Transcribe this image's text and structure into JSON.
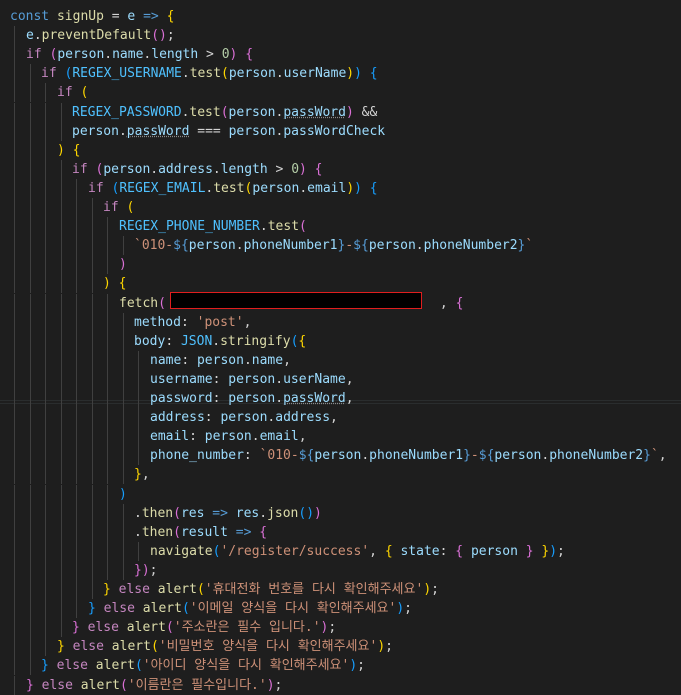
{
  "editor": {
    "lines": [
      [
        [
          "kw",
          "const"
        ],
        [
          "pun",
          " "
        ],
        [
          "fn",
          "signUp"
        ],
        [
          "pun",
          " "
        ],
        [
          "pun",
          "="
        ],
        [
          "pun",
          " "
        ],
        [
          "var",
          "e"
        ],
        [
          "pun",
          " "
        ],
        [
          "kw",
          "=>"
        ],
        [
          "pun",
          " "
        ],
        [
          "p1",
          "{"
        ]
      ],
      [
        [
          "var",
          "e"
        ],
        [
          "pun",
          "."
        ],
        [
          "fn",
          "preventDefault"
        ],
        [
          "p2",
          "()"
        ],
        [
          "pun",
          ";"
        ]
      ],
      [
        [
          "ctl",
          "if"
        ],
        [
          "pun",
          " "
        ],
        [
          "p2",
          "("
        ],
        [
          "var",
          "person"
        ],
        [
          "pun",
          "."
        ],
        [
          "var",
          "name"
        ],
        [
          "pun",
          "."
        ],
        [
          "var",
          "length"
        ],
        [
          "pun",
          " > "
        ],
        [
          "num",
          "0"
        ],
        [
          "p2",
          ")"
        ],
        [
          "pun",
          " "
        ],
        [
          "p2",
          "{"
        ]
      ],
      [
        [
          "ctl",
          "if"
        ],
        [
          "pun",
          " "
        ],
        [
          "p3",
          "("
        ],
        [
          "cst",
          "REGEX_USERNAME"
        ],
        [
          "pun",
          "."
        ],
        [
          "fn",
          "test"
        ],
        [
          "p1",
          "("
        ],
        [
          "var",
          "person"
        ],
        [
          "pun",
          "."
        ],
        [
          "var",
          "userName"
        ],
        [
          "p1",
          ")"
        ],
        [
          "p3",
          ")"
        ],
        [
          "pun",
          " "
        ],
        [
          "p3",
          "{"
        ]
      ],
      [
        [
          "ctl",
          "if"
        ],
        [
          "pun",
          " "
        ],
        [
          "p1",
          "("
        ]
      ],
      [
        [
          "cst",
          "REGEX_PASSWORD"
        ],
        [
          "pun",
          "."
        ],
        [
          "fn",
          "test"
        ],
        [
          "p2",
          "("
        ],
        [
          "var",
          "person"
        ],
        [
          "pun",
          "."
        ],
        [
          "var",
          "passWord"
        ],
        [
          "p2",
          ")"
        ],
        [
          "pun",
          " &&"
        ]
      ],
      [
        [
          "var",
          "person"
        ],
        [
          "pun",
          "."
        ],
        [
          "var",
          "passWord"
        ],
        [
          "pun",
          " === "
        ],
        [
          "var",
          "person"
        ],
        [
          "pun",
          "."
        ],
        [
          "var",
          "passWordCheck"
        ]
      ],
      [
        [
          "p1",
          ")"
        ],
        [
          "pun",
          " "
        ],
        [
          "p1",
          "{"
        ]
      ],
      [
        [
          "ctl",
          "if"
        ],
        [
          "pun",
          " "
        ],
        [
          "p2",
          "("
        ],
        [
          "var",
          "person"
        ],
        [
          "pun",
          "."
        ],
        [
          "var",
          "address"
        ],
        [
          "pun",
          "."
        ],
        [
          "var",
          "length"
        ],
        [
          "pun",
          " > "
        ],
        [
          "num",
          "0"
        ],
        [
          "p2",
          ")"
        ],
        [
          "pun",
          " "
        ],
        [
          "p2",
          "{"
        ]
      ],
      [
        [
          "ctl",
          "if"
        ],
        [
          "pun",
          " "
        ],
        [
          "p3",
          "("
        ],
        [
          "cst",
          "REGEX_EMAIL"
        ],
        [
          "pun",
          "."
        ],
        [
          "fn",
          "test"
        ],
        [
          "p1",
          "("
        ],
        [
          "var",
          "person"
        ],
        [
          "pun",
          "."
        ],
        [
          "var",
          "email"
        ],
        [
          "p1",
          ")"
        ],
        [
          "p3",
          ")"
        ],
        [
          "pun",
          " "
        ],
        [
          "p3",
          "{"
        ]
      ],
      [
        [
          "ctl",
          "if"
        ],
        [
          "pun",
          " "
        ],
        [
          "p1",
          "("
        ]
      ],
      [
        [
          "cst",
          "REGEX_PHONE_NUMBER"
        ],
        [
          "pun",
          "."
        ],
        [
          "fn",
          "test"
        ],
        [
          "p2",
          "("
        ]
      ],
      [
        [
          "str",
          "`010-"
        ],
        [
          "kw",
          "${"
        ],
        [
          "var",
          "person"
        ],
        [
          "pun",
          "."
        ],
        [
          "var",
          "phoneNumber1"
        ],
        [
          "kw",
          "}"
        ],
        [
          "str",
          "-"
        ],
        [
          "kw",
          "${"
        ],
        [
          "var",
          "person"
        ],
        [
          "pun",
          "."
        ],
        [
          "var",
          "phoneNumber2"
        ],
        [
          "kw",
          "}"
        ],
        [
          "str",
          "`"
        ]
      ],
      [
        [
          "p2",
          ")"
        ]
      ],
      [
        [
          "p1",
          ")"
        ],
        [
          "pun",
          " "
        ],
        [
          "p1",
          "{"
        ]
      ],
      [
        [
          "fn",
          "fetch"
        ],
        [
          "p2",
          "("
        ],
        [
          "pun",
          "                                   "
        ],
        [
          "pun",
          ", "
        ],
        [
          "p2",
          "{"
        ]
      ],
      [
        [
          "var",
          "method"
        ],
        [
          "pun",
          ": "
        ],
        [
          "str",
          "'post'"
        ],
        [
          "pun",
          ","
        ]
      ],
      [
        [
          "var",
          "body"
        ],
        [
          "pun",
          ": "
        ],
        [
          "cst",
          "JSON"
        ],
        [
          "pun",
          "."
        ],
        [
          "fn",
          "stringify"
        ],
        [
          "p3",
          "("
        ],
        [
          "p1",
          "{"
        ]
      ],
      [
        [
          "var",
          "name"
        ],
        [
          "pun",
          ": "
        ],
        [
          "var",
          "person"
        ],
        [
          "pun",
          "."
        ],
        [
          "var",
          "name"
        ],
        [
          "pun",
          ","
        ]
      ],
      [
        [
          "var",
          "username"
        ],
        [
          "pun",
          ": "
        ],
        [
          "var",
          "person"
        ],
        [
          "pun",
          "."
        ],
        [
          "var",
          "userName"
        ],
        [
          "pun",
          ","
        ]
      ],
      [
        [
          "var",
          "password"
        ],
        [
          "pun",
          ": "
        ],
        [
          "var",
          "person"
        ],
        [
          "pun",
          "."
        ],
        [
          "var",
          "passWord"
        ],
        [
          "pun",
          ","
        ]
      ],
      [
        [
          "var",
          "address"
        ],
        [
          "pun",
          ": "
        ],
        [
          "var",
          "person"
        ],
        [
          "pun",
          "."
        ],
        [
          "var",
          "address"
        ],
        [
          "pun",
          ","
        ]
      ],
      [
        [
          "var",
          "email"
        ],
        [
          "pun",
          ": "
        ],
        [
          "var",
          "person"
        ],
        [
          "pun",
          "."
        ],
        [
          "var",
          "email"
        ],
        [
          "pun",
          ","
        ]
      ],
      [
        [
          "var",
          "phone_number"
        ],
        [
          "pun",
          ": "
        ],
        [
          "str",
          "`010-"
        ],
        [
          "kw",
          "${"
        ],
        [
          "var",
          "person"
        ],
        [
          "pun",
          "."
        ],
        [
          "var",
          "phoneNumber1"
        ],
        [
          "kw",
          "}"
        ],
        [
          "str",
          "-"
        ],
        [
          "kw",
          "${"
        ],
        [
          "var",
          "person"
        ],
        [
          "pun",
          "."
        ],
        [
          "var",
          "phoneNumber2"
        ],
        [
          "kw",
          "}"
        ],
        [
          "str",
          "`"
        ],
        [
          "pun",
          ","
        ]
      ],
      [
        [
          "p1",
          "}"
        ],
        [
          "pun",
          ","
        ]
      ],
      [
        [
          "p3",
          ")"
        ]
      ],
      [
        [
          "pun",
          "."
        ],
        [
          "fn",
          "then"
        ],
        [
          "p2",
          "("
        ],
        [
          "var",
          "res"
        ],
        [
          "pun",
          " "
        ],
        [
          "kw",
          "=>"
        ],
        [
          "pun",
          " "
        ],
        [
          "var",
          "res"
        ],
        [
          "pun",
          "."
        ],
        [
          "fn",
          "json"
        ],
        [
          "p3",
          "()"
        ],
        [
          "p2",
          ")"
        ]
      ],
      [
        [
          "pun",
          "."
        ],
        [
          "fn",
          "then"
        ],
        [
          "p2",
          "("
        ],
        [
          "var",
          "result"
        ],
        [
          "pun",
          " "
        ],
        [
          "kw",
          "=>"
        ],
        [
          "pun",
          " "
        ],
        [
          "p2",
          "{"
        ]
      ],
      [
        [
          "fn",
          "navigate"
        ],
        [
          "p3",
          "("
        ],
        [
          "str",
          "'/register/success'"
        ],
        [
          "pun",
          ", "
        ],
        [
          "p1",
          "{"
        ],
        [
          "pun",
          " "
        ],
        [
          "var",
          "state"
        ],
        [
          "pun",
          ": "
        ],
        [
          "p2",
          "{"
        ],
        [
          "pun",
          " "
        ],
        [
          "var",
          "person"
        ],
        [
          "pun",
          " "
        ],
        [
          "p2",
          "}"
        ],
        [
          "pun",
          " "
        ],
        [
          "p1",
          "}"
        ],
        [
          "p3",
          ")"
        ],
        [
          "pun",
          ";"
        ]
      ],
      [
        [
          "p2",
          "}"
        ],
        [
          "p2",
          ")"
        ],
        [
          "pun",
          ";"
        ]
      ],
      [
        [
          "p1",
          "}"
        ],
        [
          "pun",
          " "
        ],
        [
          "ctl",
          "else"
        ],
        [
          "pun",
          " "
        ],
        [
          "fn",
          "alert"
        ],
        [
          "p1",
          "("
        ],
        [
          "str",
          "'휴대전화 번호를 다시 확인해주세요'"
        ],
        [
          "p1",
          ")"
        ],
        [
          "pun",
          ";"
        ]
      ],
      [
        [
          "p3",
          "}"
        ],
        [
          "pun",
          " "
        ],
        [
          "ctl",
          "else"
        ],
        [
          "pun",
          " "
        ],
        [
          "fn",
          "alert"
        ],
        [
          "p3",
          "("
        ],
        [
          "str",
          "'이메일 양식을 다시 확인해주세요'"
        ],
        [
          "p3",
          ")"
        ],
        [
          "pun",
          ";"
        ]
      ],
      [
        [
          "p2",
          "}"
        ],
        [
          "pun",
          " "
        ],
        [
          "ctl",
          "else"
        ],
        [
          "pun",
          " "
        ],
        [
          "fn",
          "alert"
        ],
        [
          "p2",
          "("
        ],
        [
          "str",
          "'주소란은 필수 입니다.'"
        ],
        [
          "p2",
          ")"
        ],
        [
          "pun",
          ";"
        ]
      ],
      [
        [
          "p1",
          "}"
        ],
        [
          "pun",
          " "
        ],
        [
          "ctl",
          "else"
        ],
        [
          "pun",
          " "
        ],
        [
          "fn",
          "alert"
        ],
        [
          "p1",
          "("
        ],
        [
          "str",
          "'비밀번호 양식을 다시 확인해주세요'"
        ],
        [
          "p1",
          ")"
        ],
        [
          "pun",
          ";"
        ]
      ],
      [
        [
          "p3",
          "}"
        ],
        [
          "pun",
          " "
        ],
        [
          "ctl",
          "else"
        ],
        [
          "pun",
          " "
        ],
        [
          "fn",
          "alert"
        ],
        [
          "p3",
          "("
        ],
        [
          "str",
          "'아이디 양식을 다시 확인해주세요'"
        ],
        [
          "p3",
          ")"
        ],
        [
          "pun",
          ";"
        ]
      ],
      [
        [
          "p2",
          "}"
        ],
        [
          "pun",
          " "
        ],
        [
          "ctl",
          "else"
        ],
        [
          "pun",
          " "
        ],
        [
          "fn",
          "alert"
        ],
        [
          "p2",
          "("
        ],
        [
          "str",
          "'이름란은 필수입니다.'"
        ],
        [
          "p2",
          ")"
        ],
        [
          "pun",
          ";"
        ]
      ]
    ]
  },
  "redaction": {
    "label": "redacted-url"
  }
}
